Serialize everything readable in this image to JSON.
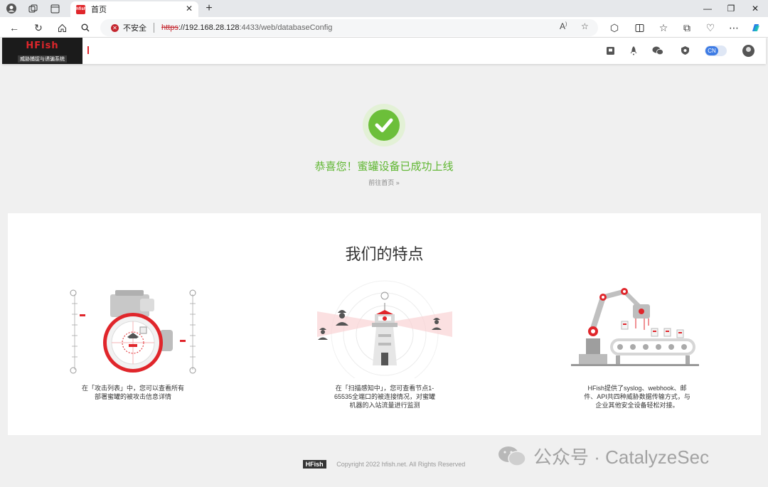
{
  "browser": {
    "tab_title": "首页",
    "tab_favicon_text": "hfish",
    "insecure_label": "不安全",
    "url_proto": "https",
    "url_host": "://192.168.28.128",
    "url_path": ":4433/web/databaseConfig"
  },
  "app": {
    "logo_title": "HFish",
    "logo_subtitle": "威胁捕捉与诱骗系统",
    "lang_toggle": "CN"
  },
  "success": {
    "message": "恭喜您！蜜罐设备已成功上线",
    "go_home": "前往首页 »"
  },
  "features": {
    "title": "我们的特点",
    "items": [
      {
        "desc": "在「攻击列表」中，您可以查看所有部署蜜罐的被攻击信息详情"
      },
      {
        "desc": "在「扫描感知中」，您可查看节点1-65535全端口的被连接情况，对蜜罐机器的入站流量进行监测"
      },
      {
        "desc": "HFish提供了syslog、webhook、邮件、API共四种威胁数据传输方式，与企业其他安全设备轻松对接。"
      }
    ]
  },
  "footer": {
    "badge": "HFish",
    "copyright": "Copyright 2022 hfish.net. All Rights Reserved"
  },
  "watermark": {
    "text": "公众号 · CatalyzeSec"
  },
  "colors": {
    "brand_red": "#e0262b",
    "success_green": "#5eb630",
    "toggle_blue": "#3d7be4"
  }
}
